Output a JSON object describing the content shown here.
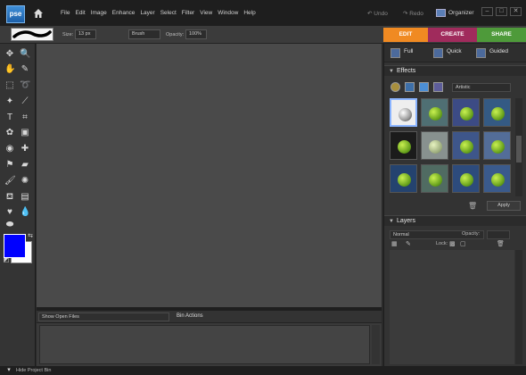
{
  "app": {
    "logo": "pse"
  },
  "menu": [
    "File",
    "Edit",
    "Image",
    "Enhance",
    "Layer",
    "Select",
    "Filter",
    "View",
    "Window",
    "Help"
  ],
  "history": {
    "undo": "Undo",
    "redo": "Redo"
  },
  "organizer": "Organizer",
  "window_buttons": {
    "minimize": "–",
    "maximize": "□",
    "close": "✕"
  },
  "options": {
    "size_label": "Size:",
    "size_value": "13 px",
    "mode_value": "Brush",
    "opacity_label": "Opacity:",
    "opacity_value": "100%"
  },
  "tabs": {
    "edit": "EDIT",
    "create": "CREATE",
    "share": "SHARE"
  },
  "colors": {
    "foreground": "#0000ff",
    "background": "#ffffff",
    "edit_tab": "#f08a22",
    "create_tab": "#a02b5c",
    "share_tab": "#4e9a3a"
  },
  "modes": {
    "full": "Full",
    "quick": "Quick",
    "guided": "Guided"
  },
  "effects": {
    "title": "Effects",
    "category": "Artistic",
    "apply": "Apply",
    "thumbnail_count": 16,
    "selected_index": 0
  },
  "layers": {
    "title": "Layers",
    "blend_mode": "Normal",
    "opacity_label": "Opacity:",
    "lock_label": "Lock:"
  },
  "bin": {
    "select": "Show Open Files",
    "actions": "Bin Actions"
  },
  "status": {
    "hide_bin": "Hide Project Bin"
  }
}
